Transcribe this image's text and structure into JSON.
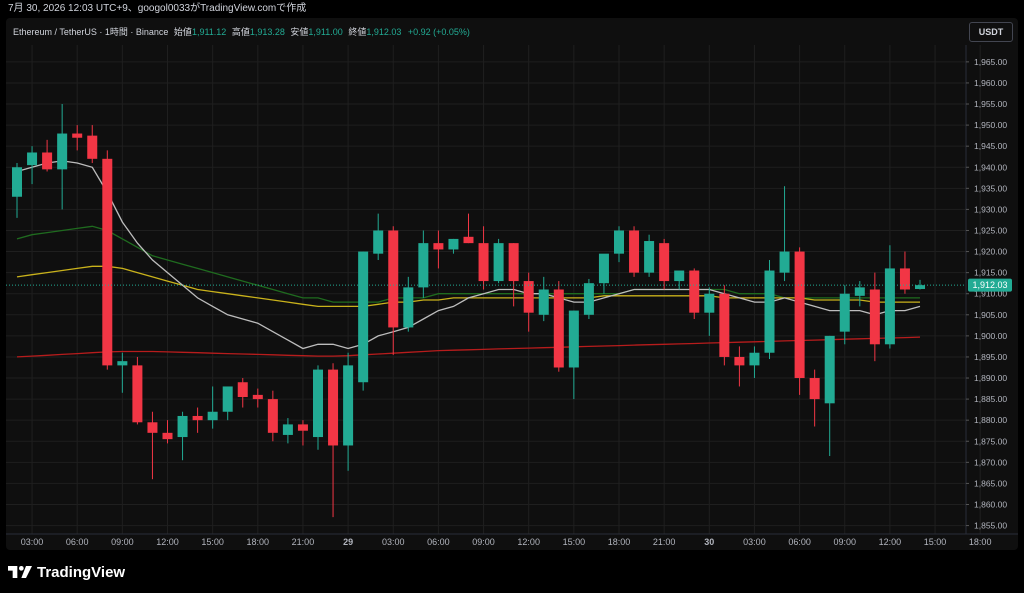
{
  "header": {
    "timestamp": "7月 30, 2026 12:03 UTC+9、googol0033がTradingView.comで作成"
  },
  "legend": {
    "symbol": "Ethereum / TetherUS · 1時間 · Binance",
    "open_label": "始値",
    "open": "1,911.12",
    "high_label": "高値",
    "high": "1,913.28",
    "low_label": "安値",
    "low": "1,911.00",
    "close_label": "終値",
    "close": "1,912.03",
    "change": "+0.92 (+0.05%)"
  },
  "currency_button": "USDT",
  "price_tag": "1,912.03",
  "brand": "TradingView",
  "colors": {
    "up": "#22ab94",
    "down": "#f23645",
    "ma_gray": "#bdbdbd",
    "ma_green": "#1f6b1f",
    "ma_yellow": "#c9b21b",
    "ma_red": "#b71c1c",
    "background": "#0f0f0f",
    "grid": "#1f1f1f"
  },
  "chart_data": {
    "type": "candlestick",
    "title": "Ethereum / TetherUS · 1時間 · Binance",
    "ylim": [
      1853,
      1969
    ],
    "y_ticks": [
      "1,855.00",
      "1,860.00",
      "1,865.00",
      "1,870.00",
      "1,875.00",
      "1,880.00",
      "1,885.00",
      "1,890.00",
      "1,895.00",
      "1,900.00",
      "1,905.00",
      "1,910.00",
      "1,915.00",
      "1,920.00",
      "1,925.00",
      "1,930.00",
      "1,935.00",
      "1,940.00",
      "1,945.00",
      "1,950.00",
      "1,955.00",
      "1,960.00",
      "1,965.00"
    ],
    "x_ticks": [
      {
        "label": "03:00",
        "i": 1
      },
      {
        "label": "06:00",
        "i": 4
      },
      {
        "label": "09:00",
        "i": 7
      },
      {
        "label": "12:00",
        "i": 10
      },
      {
        "label": "15:00",
        "i": 13
      },
      {
        "label": "18:00",
        "i": 16
      },
      {
        "label": "21:00",
        "i": 19
      },
      {
        "label": "29",
        "i": 22,
        "bold": true
      },
      {
        "label": "03:00",
        "i": 25
      },
      {
        "label": "06:00",
        "i": 28
      },
      {
        "label": "09:00",
        "i": 31
      },
      {
        "label": "12:00",
        "i": 34
      },
      {
        "label": "15:00",
        "i": 37
      },
      {
        "label": "18:00",
        "i": 40
      },
      {
        "label": "21:00",
        "i": 43
      },
      {
        "label": "30",
        "i": 46,
        "bold": true
      },
      {
        "label": "03:00",
        "i": 49
      },
      {
        "label": "06:00",
        "i": 52
      },
      {
        "label": "09:00",
        "i": 55
      },
      {
        "label": "12:00",
        "i": 58
      },
      {
        "label": "15:00",
        "i": 61
      },
      {
        "label": "18:00",
        "i": 64
      }
    ],
    "candles": [
      [
        1933.0,
        1941.0,
        1928.0,
        1940.0
      ],
      [
        1940.5,
        1945.0,
        1936.0,
        1943.5
      ],
      [
        1943.5,
        1946.5,
        1939.0,
        1939.5
      ],
      [
        1939.5,
        1955.0,
        1930.0,
        1948.0
      ],
      [
        1948.0,
        1950.0,
        1944.0,
        1947.0
      ],
      [
        1947.5,
        1950.0,
        1941.0,
        1942.0
      ],
      [
        1942.0,
        1944.0,
        1892.0,
        1893.0
      ],
      [
        1893.0,
        1896.0,
        1886.5,
        1894.0
      ],
      [
        1893.0,
        1895.0,
        1879.0,
        1879.5
      ],
      [
        1879.5,
        1882.0,
        1866.0,
        1877.0
      ],
      [
        1877.0,
        1880.0,
        1874.5,
        1875.5
      ],
      [
        1876.0,
        1882.0,
        1870.5,
        1881.0
      ],
      [
        1881.0,
        1883.0,
        1877.0,
        1880.0
      ],
      [
        1880.0,
        1888.0,
        1878.0,
        1882.0
      ],
      [
        1882.0,
        1887.5,
        1880.0,
        1888.0
      ],
      [
        1889.0,
        1890.0,
        1883.0,
        1885.5
      ],
      [
        1886.0,
        1887.5,
        1883.0,
        1885.0
      ],
      [
        1885.0,
        1887.0,
        1875.0,
        1877.0
      ],
      [
        1876.5,
        1880.5,
        1874.5,
        1879.0
      ],
      [
        1879.0,
        1880.0,
        1874.0,
        1877.5
      ],
      [
        1876.0,
        1893.0,
        1873.0,
        1892.0
      ],
      [
        1892.0,
        1893.5,
        1857.0,
        1874.0
      ],
      [
        1874.0,
        1896.0,
        1868.0,
        1893.0
      ],
      [
        1889.0,
        1920.0,
        1887.0,
        1920.0
      ],
      [
        1919.5,
        1929.0,
        1918.0,
        1925.0
      ],
      [
        1925.0,
        1926.0,
        1895.5,
        1902.0
      ],
      [
        1902.0,
        1914.0,
        1901.0,
        1911.5
      ],
      [
        1911.5,
        1925.0,
        1909.0,
        1922.0
      ],
      [
        1922.0,
        1925.0,
        1916.0,
        1920.5
      ],
      [
        1920.5,
        1923.0,
        1919.5,
        1923.0
      ],
      [
        1923.5,
        1929.0,
        1922.0,
        1922.0
      ],
      [
        1922.0,
        1926.0,
        1911.0,
        1913.0
      ],
      [
        1913.0,
        1923.0,
        1912.5,
        1922.0
      ],
      [
        1922.0,
        1922.0,
        1907.0,
        1913.0
      ],
      [
        1913.0,
        1915.0,
        1901.0,
        1905.5
      ],
      [
        1905.0,
        1914.0,
        1903.5,
        1911.0
      ],
      [
        1911.0,
        1913.0,
        1891.5,
        1892.5
      ],
      [
        1892.5,
        1906.0,
        1885.0,
        1906.0
      ],
      [
        1905.0,
        1913.5,
        1904.0,
        1912.5
      ],
      [
        1912.5,
        1919.0,
        1910.0,
        1919.5
      ],
      [
        1919.5,
        1926.0,
        1917.5,
        1925.0
      ],
      [
        1925.0,
        1926.0,
        1914.0,
        1915.0
      ],
      [
        1915.0,
        1924.0,
        1914.0,
        1922.5
      ],
      [
        1922.0,
        1923.0,
        1911.0,
        1913.0
      ],
      [
        1913.0,
        1914.0,
        1911.0,
        1915.5
      ],
      [
        1915.5,
        1916.0,
        1904.0,
        1905.5
      ],
      [
        1905.5,
        1911.5,
        1900.0,
        1910.0
      ],
      [
        1910.0,
        1912.0,
        1893.0,
        1895.0
      ],
      [
        1895.0,
        1897.5,
        1888.0,
        1893.0
      ],
      [
        1893.0,
        1897.5,
        1890.0,
        1896.0
      ],
      [
        1896.0,
        1918.0,
        1894.5,
        1915.5
      ],
      [
        1915.0,
        1935.5,
        1913.0,
        1920.0
      ],
      [
        1920.0,
        1921.0,
        1886.0,
        1890.0
      ],
      [
        1890.0,
        1892.0,
        1878.5,
        1885.0
      ],
      [
        1884.0,
        1900.0,
        1871.5,
        1900.0
      ],
      [
        1901.0,
        1912.0,
        1898.0,
        1910.0
      ],
      [
        1909.5,
        1913.0,
        1907.0,
        1911.5
      ],
      [
        1911.0,
        1915.0,
        1894.0,
        1898.0
      ],
      [
        1898.0,
        1921.5,
        1897.0,
        1916.0
      ],
      [
        1916.0,
        1920.0,
        1910.0,
        1911.0
      ],
      [
        1911.12,
        1913.28,
        1911.0,
        1912.03
      ]
    ],
    "ma_gray": [
      1939,
      1940,
      1941,
      1941.5,
      1941,
      1940,
      1934,
      1927,
      1922,
      1918,
      1915,
      1912,
      1909,
      1907,
      1905,
      1904,
      1903,
      1901,
      1899,
      1897,
      1898,
      1898,
      1897,
      1898,
      1900,
      1901,
      1902,
      1904,
      1906,
      1907,
      1909,
      1910,
      1911,
      1911,
      1910,
      1910,
      1909,
      1908,
      1908,
      1909,
      1910,
      1911,
      1911,
      1911,
      1911,
      1911,
      1911,
      1910,
      1909,
      1908,
      1908,
      1909,
      1908,
      1907,
      1906,
      1906,
      1906,
      1905,
      1906,
      1906,
      1907
    ],
    "ma_green": [
      1923,
      1924,
      1924.5,
      1925,
      1925.5,
      1926,
      1925,
      1923,
      1921,
      1919,
      1918,
      1917,
      1916,
      1915,
      1914,
      1913,
      1912,
      1911,
      1910,
      1909,
      1909,
      1908,
      1908,
      1908,
      1908,
      1909,
      1909,
      1909,
      1910,
      1910,
      1910,
      1910,
      1910,
      1910,
      1910,
      1910,
      1910,
      1910,
      1910,
      1910,
      1910,
      1911,
      1911,
      1911,
      1911,
      1911,
      1911,
      1911,
      1910,
      1910,
      1910,
      1909,
      1909,
      1909,
      1909,
      1909,
      1909,
      1909,
      1909,
      1909,
      1909
    ],
    "ma_yellow": [
      1914,
      1914.5,
      1915,
      1915.5,
      1916,
      1916.5,
      1916.5,
      1916,
      1915,
      1914,
      1913,
      1912,
      1911,
      1910.5,
      1910,
      1909.5,
      1909,
      1908.5,
      1908,
      1907.5,
      1907,
      1907,
      1907,
      1907,
      1907.5,
      1908,
      1908,
      1908.5,
      1908.5,
      1909,
      1909,
      1909,
      1909,
      1909,
      1909,
      1909,
      1909,
      1909,
      1909,
      1909.5,
      1909.5,
      1909.5,
      1909.5,
      1909.5,
      1909.5,
      1909.5,
      1909.5,
      1909,
      1909,
      1909,
      1909,
      1909,
      1909,
      1908.5,
      1908.5,
      1908.5,
      1908.5,
      1908,
      1908,
      1908,
      1908
    ],
    "ma_red": [
      1895,
      1895.2,
      1895.4,
      1895.6,
      1895.8,
      1896,
      1896.2,
      1896.3,
      1896.3,
      1896.3,
      1896.2,
      1896.1,
      1896,
      1895.9,
      1895.8,
      1895.7,
      1895.6,
      1895.5,
      1895.4,
      1895.3,
      1895.2,
      1895.2,
      1895.3,
      1895.5,
      1895.7,
      1895.9,
      1896.1,
      1896.3,
      1896.5,
      1896.6,
      1896.7,
      1896.8,
      1896.9,
      1897,
      1897.1,
      1897.2,
      1897.3,
      1897.4,
      1897.5,
      1897.6,
      1897.7,
      1897.8,
      1897.9,
      1898,
      1898.1,
      1898.2,
      1898.3,
      1898.4,
      1898.5,
      1898.6,
      1898.7,
      1898.8,
      1898.9,
      1899,
      1899.1,
      1899.2,
      1899.3,
      1899.4,
      1899.5,
      1899.6,
      1899.7
    ]
  }
}
